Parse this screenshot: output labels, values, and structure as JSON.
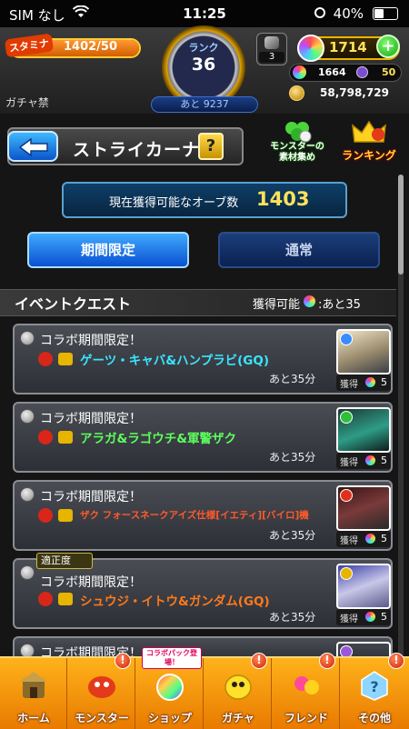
{
  "status_bar": {
    "carrier": "SIM なし",
    "time": "11:25",
    "battery": "40%"
  },
  "header": {
    "stamina_label": "スタミナ",
    "stamina_value": "1402/50",
    "stamina_fraction": 1.0,
    "gacha_ban": "ガチャ禁",
    "rank_label": "ランク",
    "rank_value": "36",
    "next_rank": "あと 9237",
    "item_count": "3",
    "orbs": "1714",
    "gem_a": "1664",
    "gem_b": "50",
    "coins": "58,798,729"
  },
  "nav": {
    "title": "ストライカーナビ",
    "help": "?",
    "materials_line1": "モンスターの",
    "materials_line2": "素材集め",
    "ranking": "ランキング"
  },
  "orb_panel": {
    "label": "現在獲得可能なオーブ数",
    "value": "1403"
  },
  "tabs": {
    "limited": "期間限定",
    "normal": "通常"
  },
  "section": {
    "title": "イベントクエスト",
    "avail_label": "獲得可能",
    "avail_value": ":あと35"
  },
  "quests": [
    {
      "category": "コラボ期間限定！",
      "name": "ゲーツ・キャバ&ハンプラビ(GQ)",
      "name_color": "#38e6ff",
      "remaining": "あと35分",
      "get_label": "獲得",
      "get_value": "5"
    },
    {
      "category": "コラボ期間限定！",
      "name": "アラガ&ラゴウチ&軍警ザク",
      "name_color": "#5dff5d",
      "remaining": "あと35分",
      "get_label": "獲得",
      "get_value": "5"
    },
    {
      "category": "コラボ期間限定！",
      "name": "ザク フォースネークアイズ仕様[イエティ][バイロ]機",
      "name_color": "#ff5a2a",
      "remaining": "あと35分",
      "get_label": "獲得",
      "get_value": "5"
    },
    {
      "category": "コラボ期間限定！",
      "name": "シュウジ・イトウ&ガンダム(GQ)",
      "name_color": "#ff7a1a",
      "remaining": "あと35分",
      "get_label": "獲得",
      "get_value": "5",
      "badge": "適正度"
    },
    {
      "category": "コラボ期間限定！"
    }
  ],
  "bottom_nav": {
    "home": "ホーム",
    "monster": "モンスター",
    "shop": "ショップ",
    "shop_tag": "コラボパック登場！",
    "gacha": "ガチャ",
    "friend": "フレンド",
    "other": "その他",
    "alert": "!"
  },
  "colors": {
    "accent_orange": "#f39a0f",
    "tab_active": "#1a6fe0",
    "gold": "#ffe25a"
  }
}
